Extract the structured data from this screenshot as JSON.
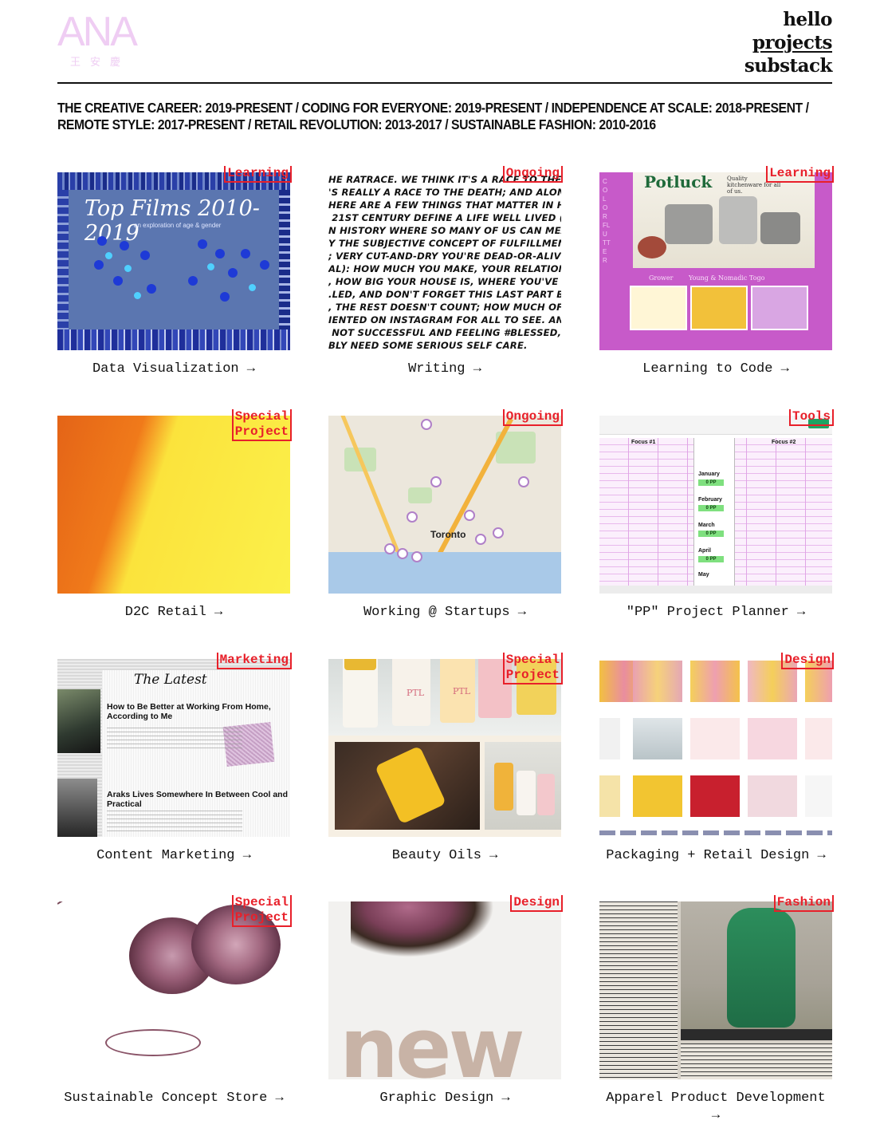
{
  "header": {
    "logo_main": "ANA",
    "logo_sub": "王安慶",
    "nav": [
      {
        "label": "hello"
      },
      {
        "label": "projects"
      },
      {
        "label": "substack"
      }
    ]
  },
  "timeline_text": "THE CREATIVE CAREER: 2019-PRESENT / CODING FOR EVERYONE: 2019-PRESENT / INDEPENDENCE AT SCALE: 2018-PRESENT / REMOTE STYLE: 2017-PRESENT / RETAIL REVOLUTION: 2013-2017 / SUSTAINABLE FASHION: 2010-2016",
  "colors": {
    "accent_tag": "#e8202a",
    "logo": "#efcdf3",
    "text": "#111111"
  },
  "projects": [
    {
      "tag": "Learning",
      "caption": "Data Visualization →"
    },
    {
      "tag": "Ongoing",
      "caption": "Writing →"
    },
    {
      "tag": "Learning",
      "caption": "Learning to Code →"
    },
    {
      "tag": "Special\nProject",
      "caption": "D2C Retail →"
    },
    {
      "tag": "Ongoing",
      "caption": "Working @ Startups →"
    },
    {
      "tag": "Tools",
      "caption": "\"PP\" Project Planner →"
    },
    {
      "tag": "Marketing",
      "caption": "Content Marketing →"
    },
    {
      "tag": "Special\nProject",
      "caption": "Beauty Oils →"
    },
    {
      "tag": "Design",
      "caption": "Packaging + Retail Design →"
    },
    {
      "tag": "Special\nProject",
      "caption": "Sustainable Concept Store →"
    },
    {
      "tag": "Design",
      "caption": "Graphic Design →"
    },
    {
      "tag": "Fashion",
      "caption": "Apparel Product Development →"
    }
  ],
  "thumb_text": {
    "dataviz_title": "Top Films 2010-2019",
    "dataviz_sub": "an exploration of age & gender",
    "writing_text": "he ratrace. We think it's a race to the c\n's really a race to the death; and along t\nhere are a few things that matter in hou\n 21st century define a life well lived (thi\nn history where so many of us can measu\ny the subjective concept of fulfillment r\n; very cut-and-dry you're dead-or-alive\nal): how much you make, your relationshi\n, how big your house is, where you've\n.led, and don't forget this last part beca\n, the rest doesn't count; how much of thi\niented on Instagram for all to see. And i\n not successful and feeling #blessed, the\nbly need some serious self care.",
    "code_title": "Potluck",
    "code_tagline": "Quality kitchenware for all of us.",
    "code_vertical": "COLORFLUTTER",
    "code_labels": [
      "Grower",
      "Young & Nomadic",
      "Togo"
    ],
    "map_city": "Toronto",
    "sheet_focus1": "Focus #1",
    "sheet_focus2": "Focus #2",
    "sheet_months": [
      "January",
      "February",
      "March",
      "April",
      "May"
    ],
    "sheet_pp": "0 PP",
    "content_latest": "The Latest",
    "content_h1": "How to Be Better at Working From Home, According to Me",
    "content_h2": "Araks Lives Somewhere In Between Cool and Practical",
    "oils_brand": "PTL",
    "graphic_word": "new"
  }
}
